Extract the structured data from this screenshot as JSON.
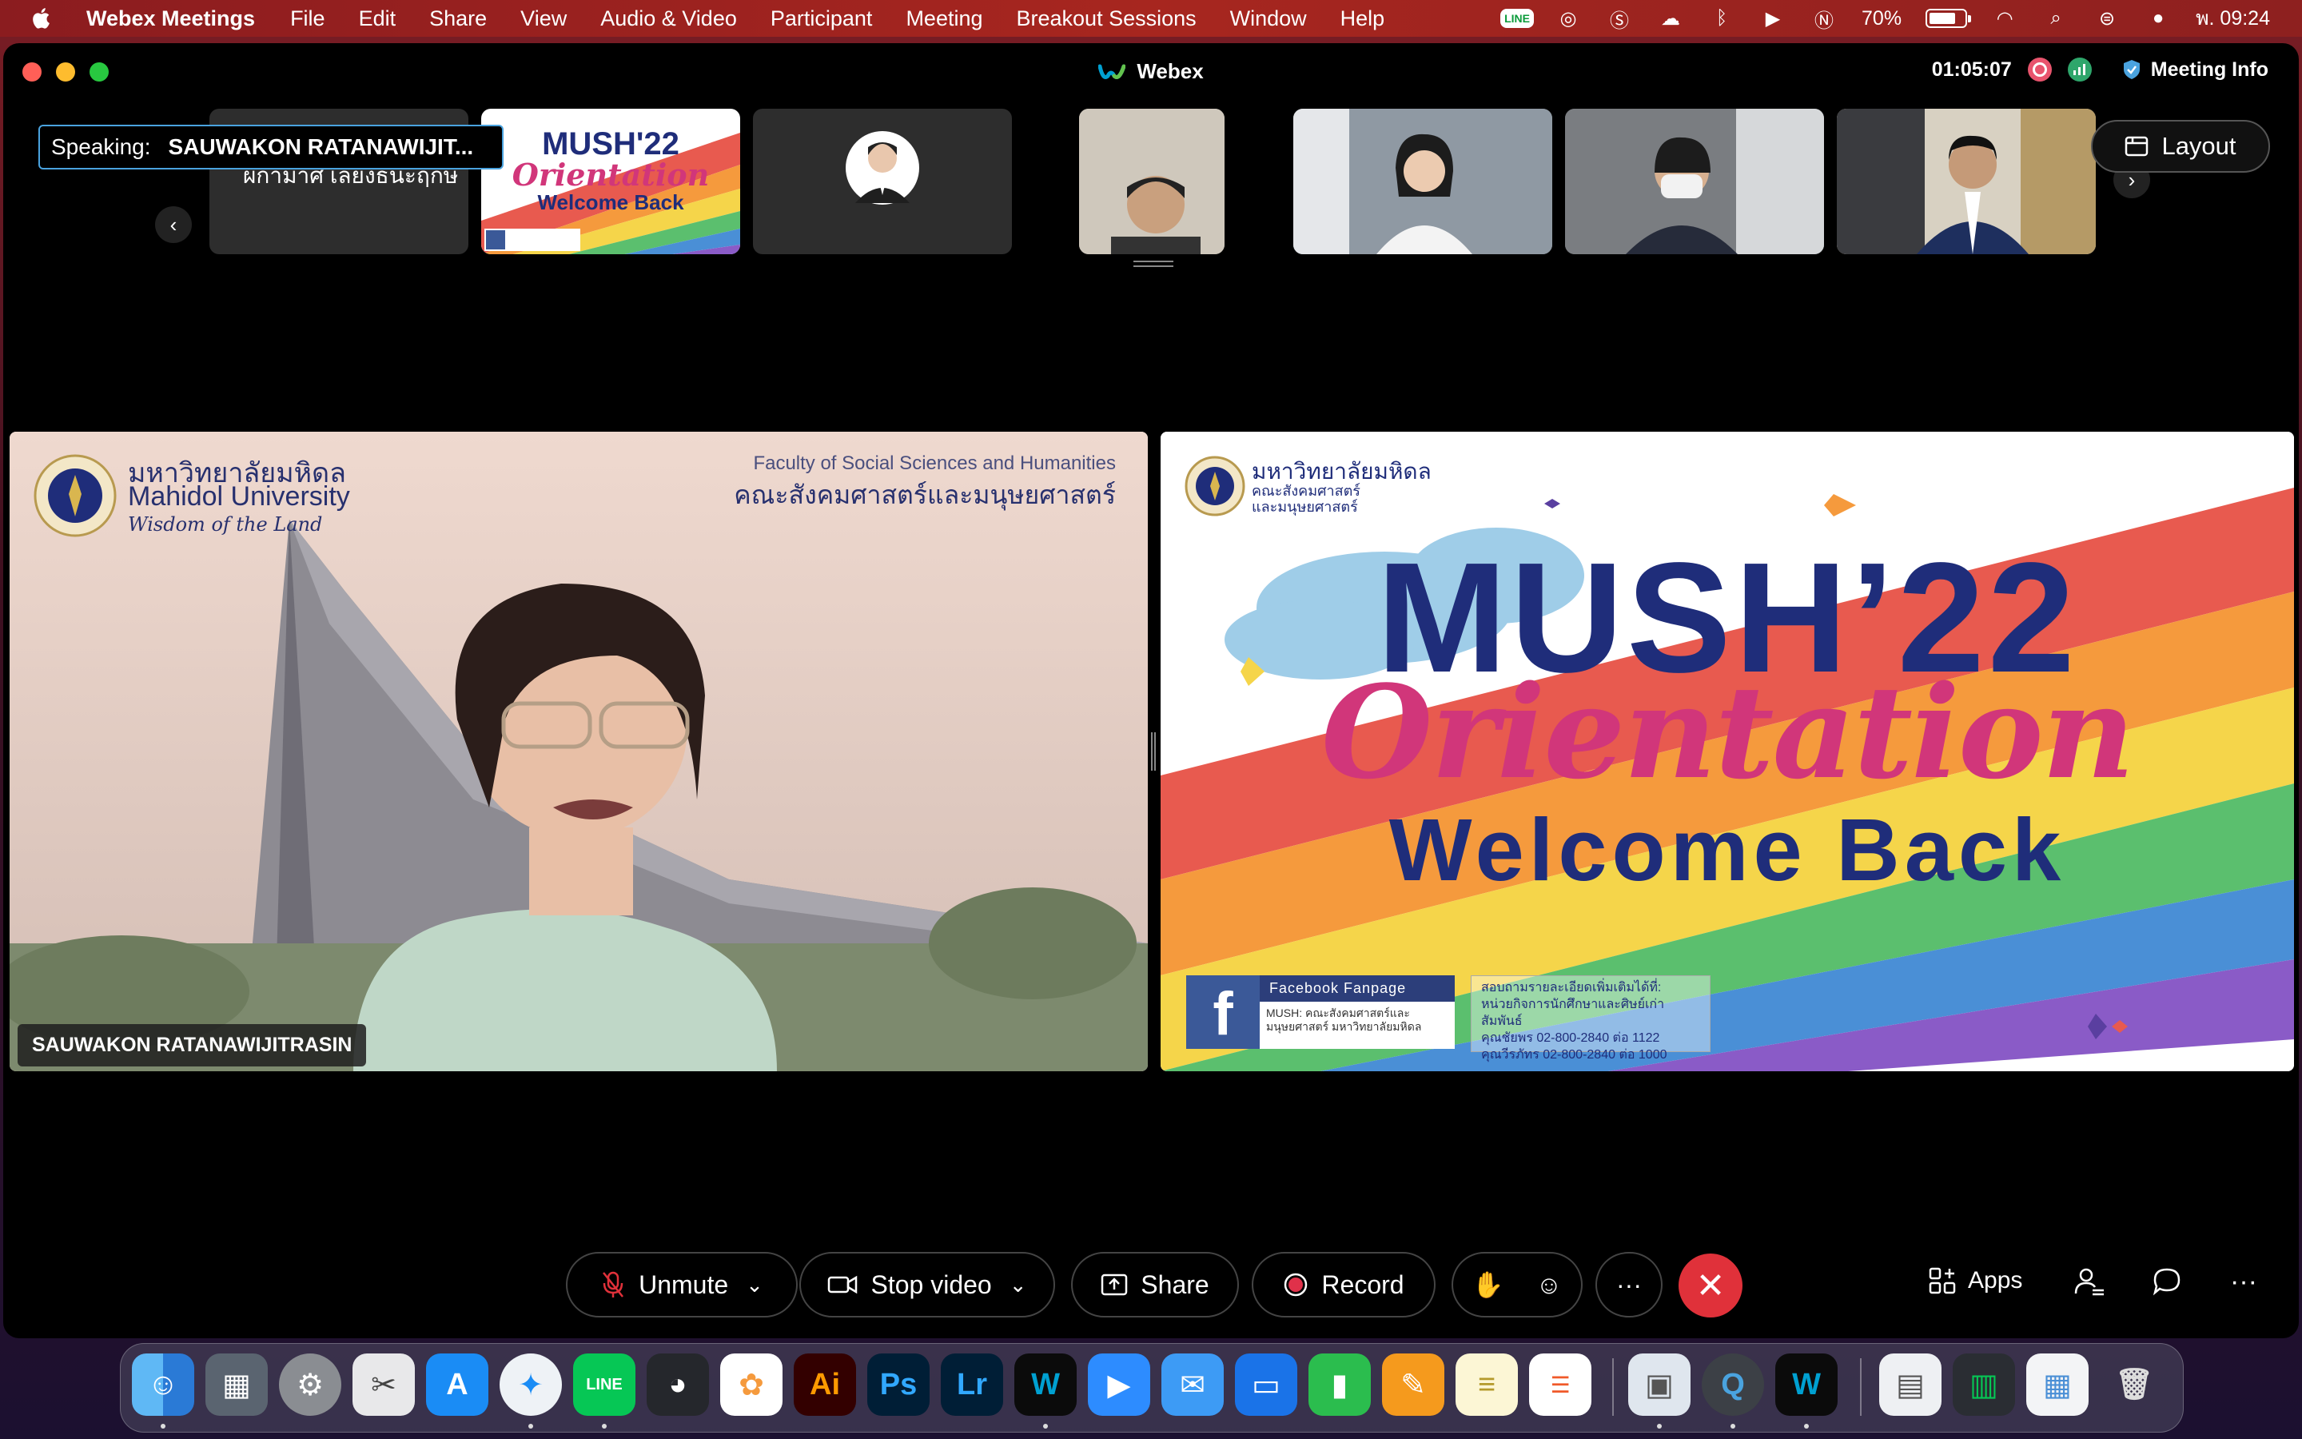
{
  "menubar": {
    "app_name": "Webex Meetings",
    "items": [
      "File",
      "Edit",
      "Share",
      "View",
      "Audio & Video",
      "Participant",
      "Meeting",
      "Breakout Sessions",
      "Window",
      "Help"
    ],
    "tray_line": "LINE",
    "battery": "70%",
    "battery_level": 0.7,
    "clock": "พ. 09:24"
  },
  "window": {
    "title": "Webex",
    "timer": "01:05:07",
    "meeting_info": "Meeting Info"
  },
  "filmstrip": {
    "speaking_label": "Speaking:",
    "speaking_name": "SAUWAKON RATANAWIJIT...",
    "tile1_name": "ผกามาศ เลี้ยงธนะฤกษ์",
    "thumb_title1": "MUSH'22",
    "thumb_title2": "Orientation",
    "thumb_title3": "Welcome Back",
    "layout_label": "Layout"
  },
  "video_left": {
    "uni_thai": "มหาวิทยาลัยมหิดล",
    "uni_en": "Mahidol University",
    "motto": "Wisdom of the Land",
    "faculty_en": "Faculty of Social Sciences and Humanities",
    "faculty_th": "คณะสังคมศาสตร์และมนุษยศาสตร์",
    "participant_name": "SAUWAKON RATANAWIJITRASIN"
  },
  "slide": {
    "uni_thai": "มหาวิทยาลัยมหิดล",
    "faculty_th": "คณะสังคมศาสตร์ และมนุษยศาสตร์",
    "title_line1": "MUSH’22",
    "title_line2": "Orientation",
    "title_line3": "Welcome Back",
    "fb_heading": "Facebook Fanpage",
    "fb_text": "MUSH: คณะสังคมศาสตร์และมนุษยศาสตร์ มหาวิทยาลัยมหิดล",
    "contact_lines": [
      "สอบถามรายละเอียดเพิ่มเติมได้ที่:",
      "หน่วยกิจการนักศึกษาและศิษย์เก่าสัมพันธ์",
      "คุณชัยพร  02-800-2840 ต่อ 1122",
      "คุณวีรภัทร  02-800-2840 ต่อ 1000"
    ]
  },
  "controls": {
    "unmute": "Unmute",
    "stop_video": "Stop video",
    "share": "Share",
    "record": "Record",
    "more": "···",
    "apps": "Apps"
  },
  "dock": {
    "apps": [
      "Finder",
      "Launchpad",
      "System Preferences",
      "Preview",
      "App Store",
      "Safari",
      "LINE",
      "DaVinci Resolve",
      "Photos",
      "Illustrator",
      "Photoshop",
      "Lightroom",
      "Webex",
      "Zoom",
      "Mail",
      "Keynote",
      "Numbers",
      "Pages",
      "Notes",
      "Reminders",
      "Preview",
      "QuickTime",
      "Webex Meetings",
      "Trash"
    ]
  },
  "colors": {
    "menubar": "#a7261f",
    "end_call": "#e0313a",
    "speaking_border": "#4aa3df",
    "slide_navy": "#1f2d7a",
    "slide_pink": "#d1367a"
  }
}
